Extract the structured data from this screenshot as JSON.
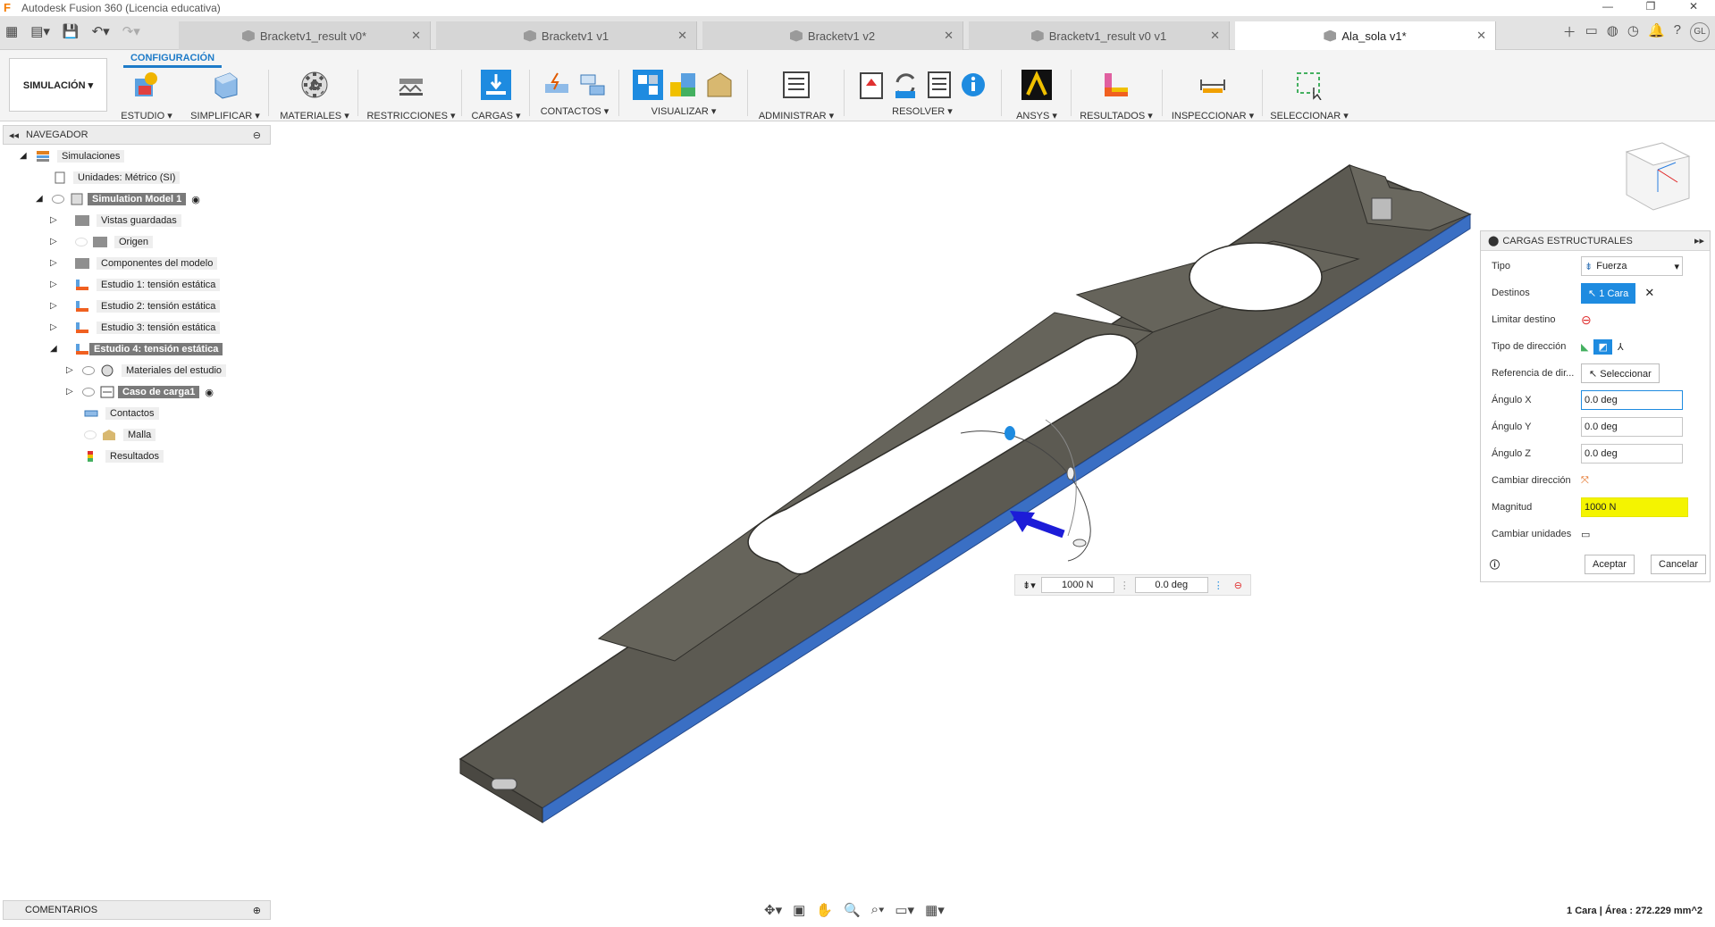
{
  "window": {
    "title": "Autodesk Fusion 360 (Licencia educativa)"
  },
  "tabs": [
    {
      "label": "Bracketv1_result v0*"
    },
    {
      "label": "Bracketv1 v1"
    },
    {
      "label": "Bracketv1 v2"
    },
    {
      "label": "Bracketv1_result v0 v1"
    },
    {
      "label": "Ala_sola v1*"
    }
  ],
  "user": {
    "initials": "GL"
  },
  "ribbon": {
    "active_tab": "CONFIGURACIÓN",
    "workspace": "SIMULACIÓN ▾",
    "groups": [
      {
        "label": "ESTUDIO ▾"
      },
      {
        "label": "SIMPLIFICAR ▾"
      },
      {
        "label": "MATERIALES ▾"
      },
      {
        "label": "RESTRICCIONES ▾"
      },
      {
        "label": "CARGAS ▾"
      },
      {
        "label": "CONTACTOS ▾"
      },
      {
        "label": "VISUALIZAR ▾"
      },
      {
        "label": "ADMINISTRAR ▾"
      },
      {
        "label": "RESOLVER ▾"
      },
      {
        "label": "ANSYS ▾"
      },
      {
        "label": "RESULTADOS ▾"
      },
      {
        "label": "INSPECCIONAR ▾"
      },
      {
        "label": "SELECCIONAR ▾"
      }
    ]
  },
  "navigator": {
    "title": "NAVEGADOR",
    "items": [
      {
        "label": "Simulaciones"
      },
      {
        "label": "Unidades: Métrico (SI)"
      },
      {
        "label": "Simulation Model 1"
      },
      {
        "label": "Vistas guardadas"
      },
      {
        "label": "Origen"
      },
      {
        "label": "Componentes del modelo"
      },
      {
        "label": "Estudio 1: tensión estática"
      },
      {
        "label": "Estudio 2: tensión estática"
      },
      {
        "label": "Estudio 3: tensión estática"
      },
      {
        "label": "Estudio 4: tensión estática"
      },
      {
        "label": "Materiales del estudio"
      },
      {
        "label": "Caso de carga1"
      },
      {
        "label": "Contactos"
      },
      {
        "label": "Malla"
      },
      {
        "label": "Resultados"
      }
    ]
  },
  "panel": {
    "title": "CARGAS ESTRUCTURALES",
    "tipo_label": "Tipo",
    "tipo_value": "Fuerza",
    "destinos_label": "Destinos",
    "destinos_value": "1 Cara",
    "limitar_label": "Limitar destino",
    "tipo_dir_label": "Tipo de dirección",
    "ref_label": "Referencia de dir...",
    "ref_button": "Seleccionar",
    "ang_x_label": "Ángulo X",
    "ang_x": "0.0 deg",
    "ang_y_label": "Ángulo Y",
    "ang_y": "0.0 deg",
    "ang_z_label": "Ángulo Z",
    "ang_z": "0.0 deg",
    "cambiar_dir_label": "Cambiar dirección",
    "magnitud_label": "Magnitud",
    "magnitud": "1000 N",
    "cambiar_unid_label": "Cambiar unidades",
    "ok": "Aceptar",
    "cancel": "Cancelar"
  },
  "hud": {
    "magnitude": "1000 N",
    "angle": "0.0 deg"
  },
  "comments": {
    "title": "COMENTARIOS"
  },
  "status": {
    "selection": "1 Cara | Área : 272.229 mm^2"
  },
  "colors": {
    "accent": "#1e7bc8",
    "face_selected": "#3a6fc4",
    "body": "#5c5a52",
    "highlight": "#f4f400"
  }
}
